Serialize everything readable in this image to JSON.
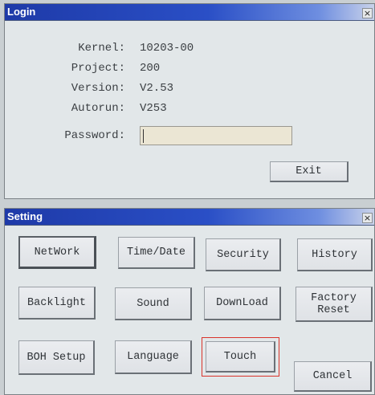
{
  "login": {
    "title": "Login",
    "close_label": "×",
    "info": [
      {
        "label": "Kernel:",
        "value": "10203-00"
      },
      {
        "label": "Project:",
        "value": "200"
      },
      {
        "label": "Version:",
        "value": "V2.53"
      },
      {
        "label": "Autorun:",
        "value": "V253"
      }
    ],
    "password_label": "Password:",
    "password_value": "",
    "exit_label": "Exit"
  },
  "setting": {
    "title": "Setting",
    "close_label": "×",
    "buttons": {
      "network": "NetWork",
      "time_date": "Time/Date",
      "security": "Security",
      "history": "History",
      "backlight": "Backlight",
      "sound": "Sound",
      "download": "DownLoad",
      "factory_reset_line1": "Factory",
      "factory_reset_line2": "Reset",
      "boh_setup": "BOH Setup",
      "language": "Language",
      "touch": "Touch",
      "cancel": "Cancel"
    },
    "highlight_color": "#d9342b"
  }
}
